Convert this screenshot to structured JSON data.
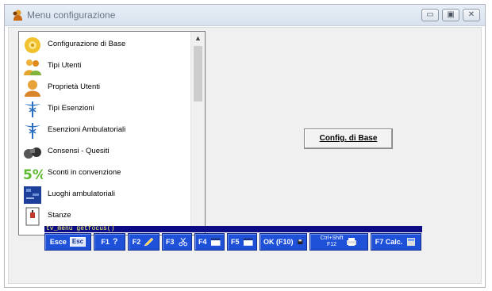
{
  "window": {
    "title": "Menu configurazione",
    "controls": [
      "minimize-icon",
      "maximize-icon",
      "close-icon"
    ]
  },
  "menu_list": {
    "items": [
      {
        "label": "Configurazione di Base",
        "icon": "gear-sun-icon"
      },
      {
        "label": "Tipi Utenti",
        "icon": "users-group-icon"
      },
      {
        "label": "Proprietà Utenti",
        "icon": "user-properties-icon"
      },
      {
        "label": "Tipi Esenzioni",
        "icon": "caduceus-icon"
      },
      {
        "label": "Esenzioni Ambulatoriali",
        "icon": "caduceus-icon"
      },
      {
        "label": "Consensi - Quesiti",
        "icon": "binoculars-icon"
      },
      {
        "label": "Sconti in convenzione",
        "icon": "percent-icon"
      },
      {
        "label": "Luoghi ambulatoriali",
        "icon": "map-icon"
      },
      {
        "label": "Stanze",
        "icon": "door-icon"
      }
    ]
  },
  "action_button": {
    "label": "Config. di Base"
  },
  "status": {
    "text": "tv_menu getfocus()"
  },
  "function_keys": [
    {
      "label": "Esce",
      "key": "Esc",
      "icon": "esc-key-icon"
    },
    {
      "label": "F1",
      "key": "?",
      "icon": "help-icon"
    },
    {
      "label": "F2",
      "key": "",
      "icon": "pencil-icon"
    },
    {
      "label": "F3",
      "key": "",
      "icon": "scissors-icon"
    },
    {
      "label": "F4",
      "key": "",
      "icon": "window-icon"
    },
    {
      "label": "F5",
      "key": "",
      "icon": "window-icon"
    },
    {
      "label": "OK (F10)",
      "key": "",
      "icon": "save-disk-icon"
    },
    {
      "label": "Ctrl+Shift",
      "key": "F12",
      "icon": "printer-icon"
    },
    {
      "label": "F7 Calc.",
      "key": "",
      "icon": "calculator-icon"
    }
  ]
}
